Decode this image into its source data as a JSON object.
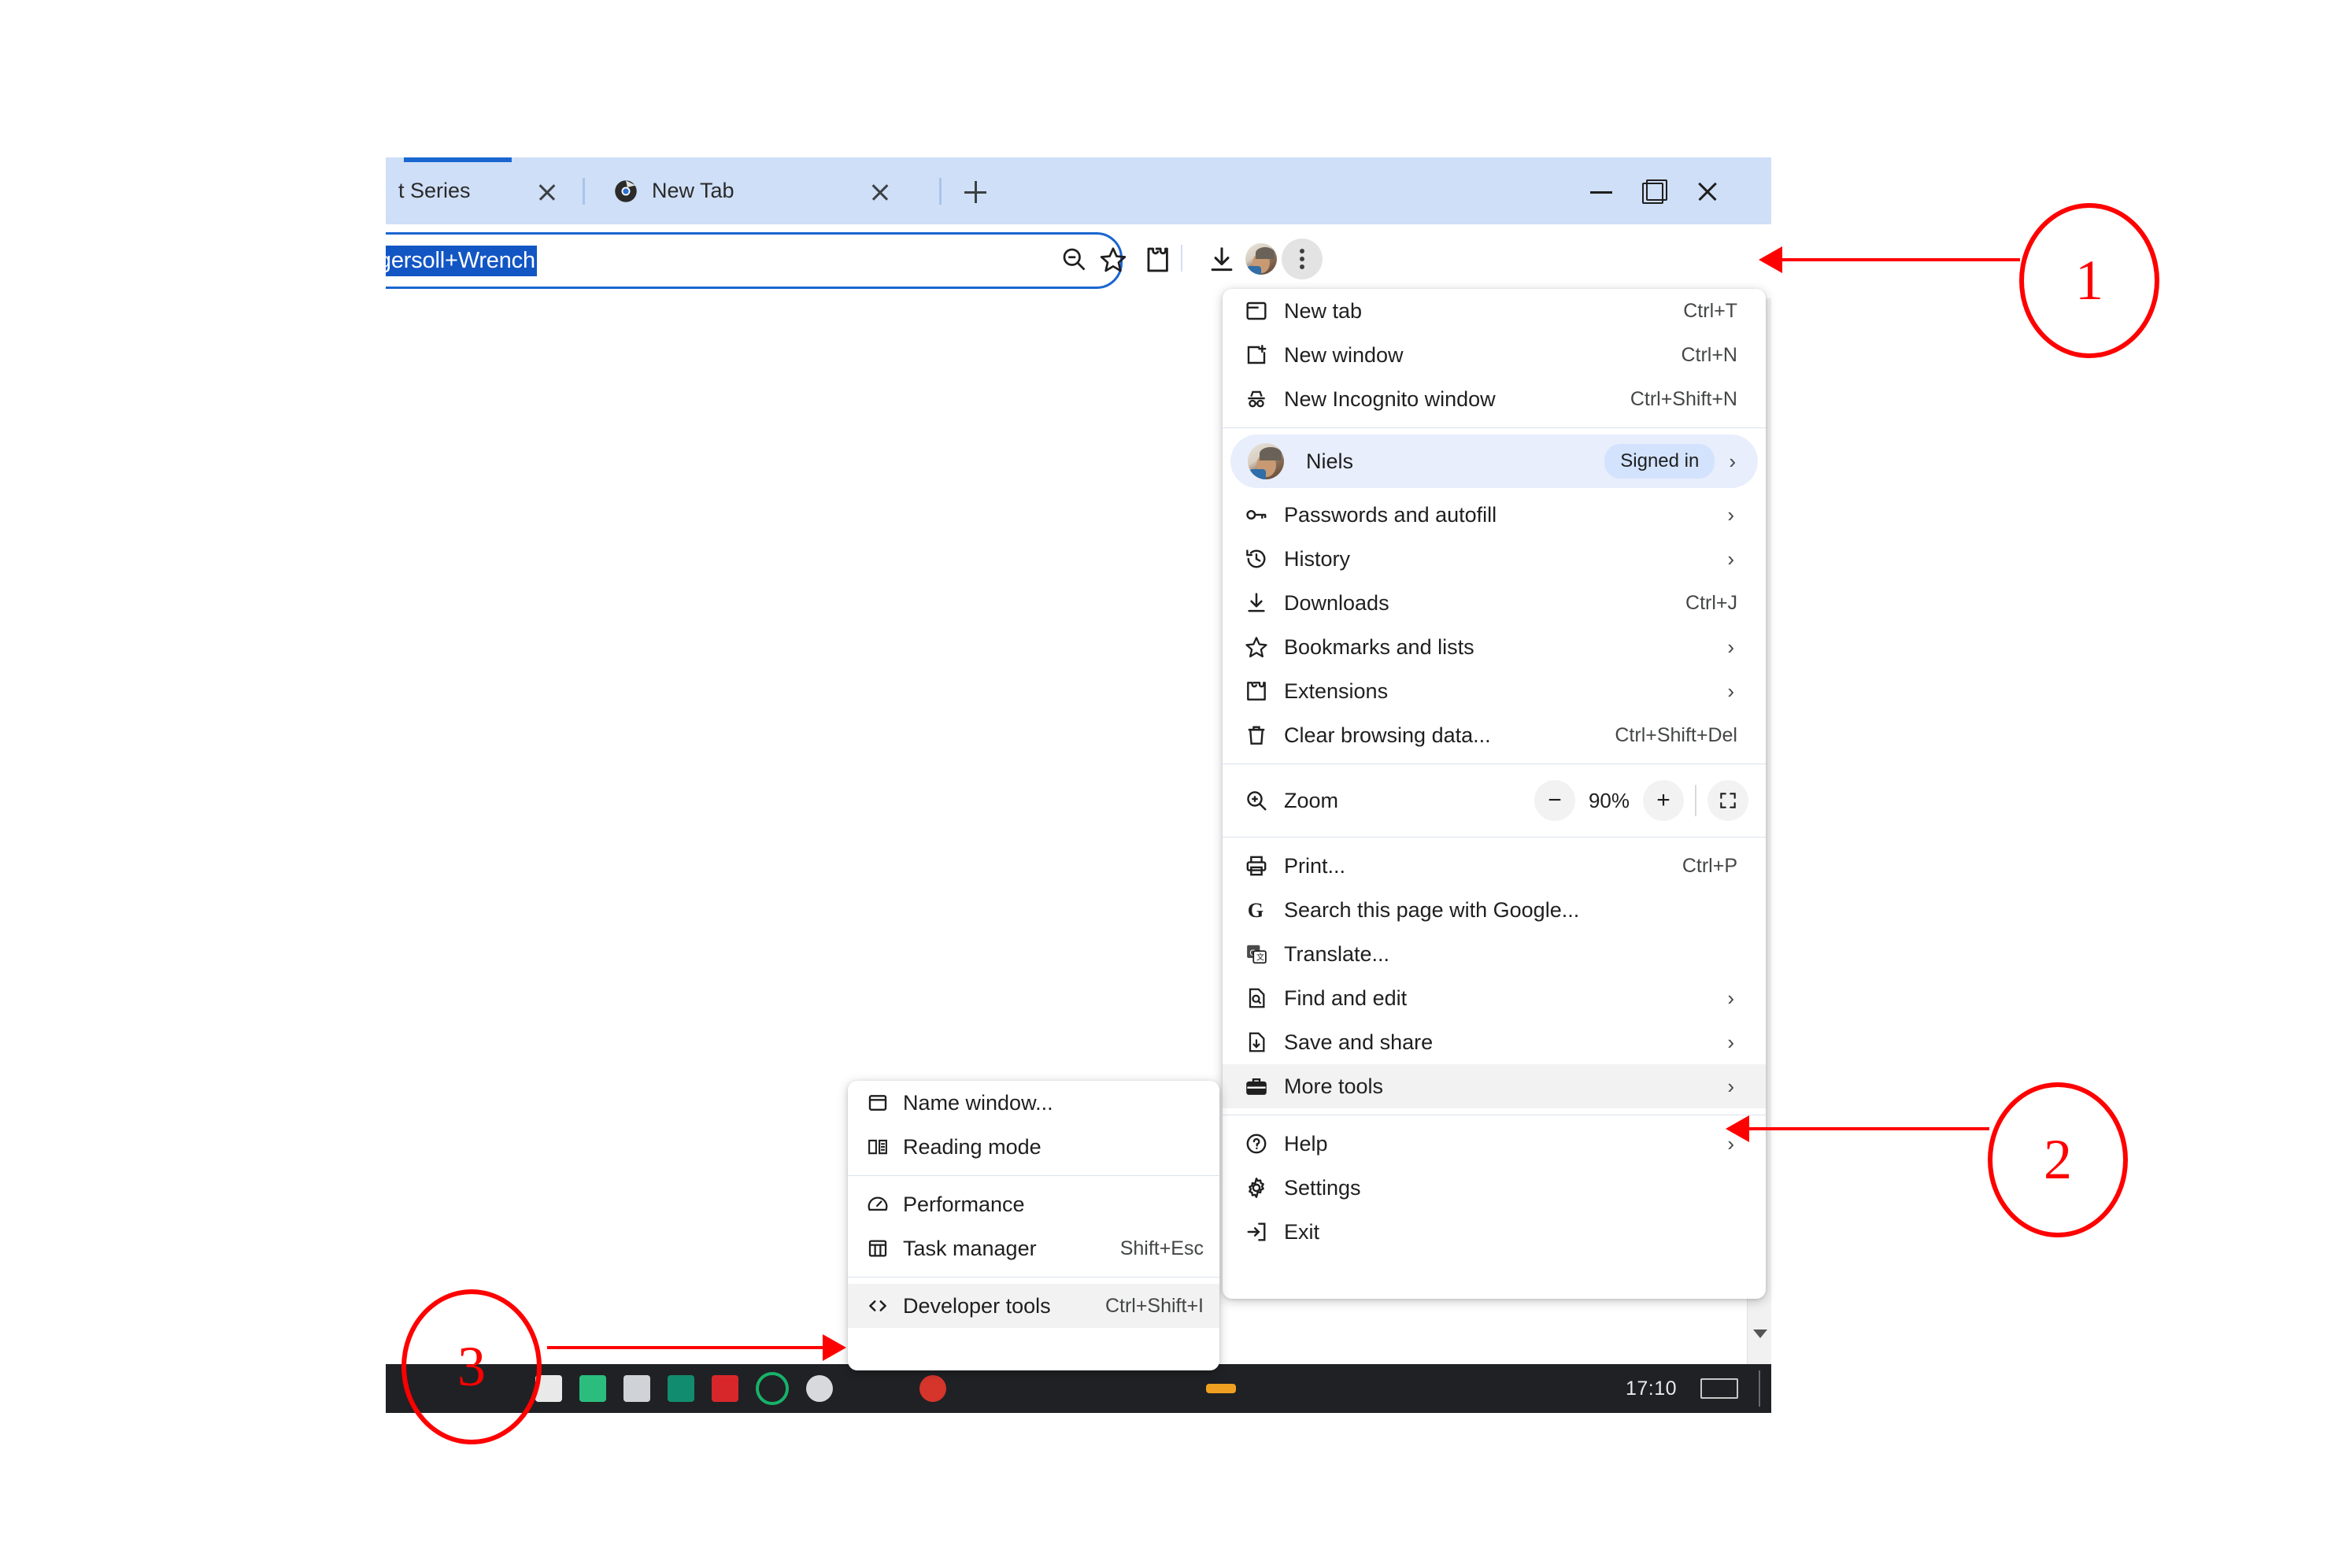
{
  "window": {
    "tabs": [
      {
        "title": "t Series",
        "favicon": "none",
        "close_label": "x",
        "active": true
      },
      {
        "title": "New Tab",
        "favicon": "chrome-icon",
        "close_label": "x",
        "active": false
      }
    ],
    "new_tab_button": "+",
    "controls": {
      "minimize": "minimize",
      "maximize": "maximize",
      "close": "close"
    }
  },
  "toolbar": {
    "omnibox_value": "ngersoll+Wrench",
    "icons": [
      "zoom-out-icon",
      "bookmark-star-icon",
      "extensions-icon",
      "downloads-icon",
      "profile-avatar-icon",
      "chrome-menu-icon"
    ]
  },
  "menu": {
    "groups": [
      {
        "items": [
          {
            "label": "New tab",
            "accel": "Ctrl+T",
            "icon": "new-tab-icon",
            "chevron": false
          },
          {
            "label": "New window",
            "accel": "Ctrl+N",
            "icon": "new-window-icon",
            "chevron": false
          },
          {
            "label": "New Incognito window",
            "accel": "Ctrl+Shift+N",
            "icon": "incognito-icon",
            "chevron": false
          }
        ]
      },
      {
        "profile": {
          "name": "Niels",
          "badge": "Signed in",
          "avatar": "profile-avatar-icon",
          "chevron": true
        },
        "items": [
          {
            "label": "Passwords and autofill",
            "accel": "",
            "icon": "key-icon",
            "chevron": true
          },
          {
            "label": "History",
            "accel": "",
            "icon": "history-icon",
            "chevron": true
          },
          {
            "label": "Downloads",
            "accel": "Ctrl+J",
            "icon": "download-icon",
            "chevron": false
          },
          {
            "label": "Bookmarks and lists",
            "accel": "",
            "icon": "star-icon",
            "chevron": true
          },
          {
            "label": "Extensions",
            "accel": "",
            "icon": "puzzle-icon",
            "chevron": true
          },
          {
            "label": "Clear browsing data...",
            "accel": "Ctrl+Shift+Del",
            "icon": "trash-icon",
            "chevron": false
          }
        ]
      },
      {
        "zoom": {
          "label": "Zoom",
          "icon": "zoom-icon",
          "minus": "−",
          "level": "90%",
          "plus": "+",
          "fullscreen": "fullscreen-icon"
        }
      },
      {
        "items": [
          {
            "label": "Print...",
            "accel": "Ctrl+P",
            "icon": "printer-icon",
            "chevron": false
          },
          {
            "label": "Search this page with Google...",
            "accel": "",
            "icon": "google-g-icon",
            "chevron": false
          },
          {
            "label": "Translate...",
            "accel": "",
            "icon": "translate-icon",
            "chevron": false
          },
          {
            "label": "Find and edit",
            "accel": "",
            "icon": "find-icon",
            "chevron": true
          },
          {
            "label": "Save and share",
            "accel": "",
            "icon": "save-share-icon",
            "chevron": true
          },
          {
            "label": "More tools",
            "accel": "",
            "icon": "toolbox-icon",
            "chevron": true,
            "highlighted": true
          }
        ]
      },
      {
        "items": [
          {
            "label": "Help",
            "accel": "",
            "icon": "help-circle-icon",
            "chevron": true
          },
          {
            "label": "Settings",
            "accel": "",
            "icon": "gear-icon",
            "chevron": false
          },
          {
            "label": "Exit",
            "accel": "",
            "icon": "exit-icon",
            "chevron": false
          }
        ]
      }
    ]
  },
  "submenu": {
    "groups": [
      {
        "items": [
          {
            "label": "Name window...",
            "accel": "",
            "icon": "window-icon"
          },
          {
            "label": "Reading mode",
            "accel": "",
            "icon": "book-icon"
          }
        ]
      },
      {
        "items": [
          {
            "label": "Performance",
            "accel": "",
            "icon": "gauge-icon"
          },
          {
            "label": "Task manager",
            "accel": "Shift+Esc",
            "icon": "table-icon"
          }
        ]
      },
      {
        "items": [
          {
            "label": "Developer tools",
            "accel": "Ctrl+Shift+I",
            "icon": "code-brackets-icon",
            "highlighted": true
          }
        ]
      }
    ]
  },
  "taskbar": {
    "clock": "17:10"
  },
  "annotations": {
    "markers": [
      {
        "number": "1",
        "target": "chrome-menu-button"
      },
      {
        "number": "2",
        "target": "more-tools-item"
      },
      {
        "number": "3",
        "target": "developer-tools-item"
      }
    ]
  },
  "colors": {
    "accent_red": "#ff0000",
    "tabstrip_blue": "#cfdff7",
    "omnibox_border": "#1a66d0",
    "selection_blue": "#1256c4",
    "highlight_gray": "#f2f2f2",
    "profile_row_blue": "#e8eefc",
    "badge_blue": "#d3e3fd",
    "taskbar_dark": "#202124"
  }
}
